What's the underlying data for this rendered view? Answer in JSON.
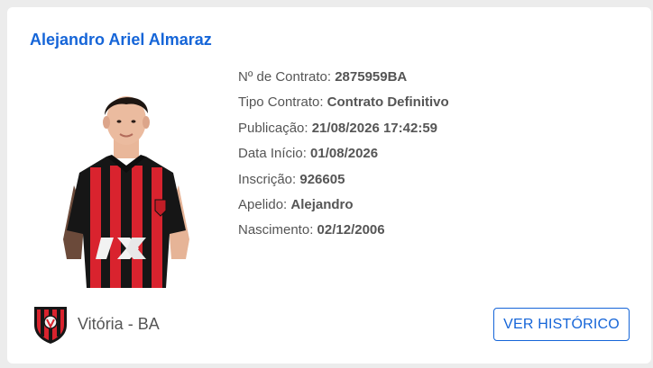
{
  "player": {
    "name": "Alejandro Ariel Almaraz",
    "photo_alt": "player-photo"
  },
  "details": [
    {
      "label": "Nº de Contrato: ",
      "value": "2875959BA"
    },
    {
      "label": "Tipo Contrato: ",
      "value": "Contrato Definitivo"
    },
    {
      "label": "Publicação: ",
      "value": "21/08/2026 17:42:59"
    },
    {
      "label": "Data Início: ",
      "value": "01/08/2026"
    },
    {
      "label": "Inscrição: ",
      "value": "926605"
    },
    {
      "label": "Apelido: ",
      "value": "Alejandro"
    },
    {
      "label": "Nascimento: ",
      "value": "02/12/2006"
    }
  ],
  "club": {
    "name": "Vitória - BA",
    "crest_icon": "vitoria-crest-icon"
  },
  "actions": {
    "history_button_label": "VER HISTÓRICO"
  },
  "colors": {
    "accent": "#1565d8",
    "club_red": "#d9232e",
    "club_black": "#161616"
  }
}
